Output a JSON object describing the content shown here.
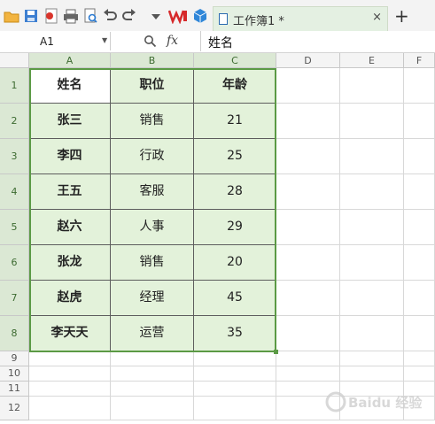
{
  "toolbar": {
    "icons": [
      "open-folder-icon",
      "save-icon",
      "export-pdf-icon",
      "print-icon",
      "print-preview-icon",
      "undo-icon",
      "redo-icon",
      "dropdown-icon",
      "wps-logo-icon",
      "cube-app-icon"
    ]
  },
  "tab": {
    "title": "工作簿1 *",
    "close": "×",
    "new_tab": "+"
  },
  "formula_bar": {
    "name_box": "A1",
    "fx_label": "fx",
    "content": "姓名"
  },
  "columns": [
    "A",
    "B",
    "C",
    "D",
    "E",
    "F"
  ],
  "rows": [
    "1",
    "2",
    "3",
    "4",
    "5",
    "6",
    "7",
    "8",
    "9",
    "10",
    "11",
    "12"
  ],
  "table": {
    "header": [
      "姓名",
      "职位",
      "年龄"
    ],
    "records": [
      [
        "张三",
        "销售",
        "21"
      ],
      [
        "李四",
        "行政",
        "25"
      ],
      [
        "王五",
        "客服",
        "28"
      ],
      [
        "赵六",
        "人事",
        "29"
      ],
      [
        "张龙",
        "销售",
        "20"
      ],
      [
        "赵虎",
        "经理",
        "45"
      ],
      [
        "李天天",
        "运营",
        "35"
      ]
    ]
  },
  "colors": {
    "table_fill": "#e3f2da",
    "selection_border": "#5b9a45",
    "tab_fill": "#e4f0e2"
  }
}
